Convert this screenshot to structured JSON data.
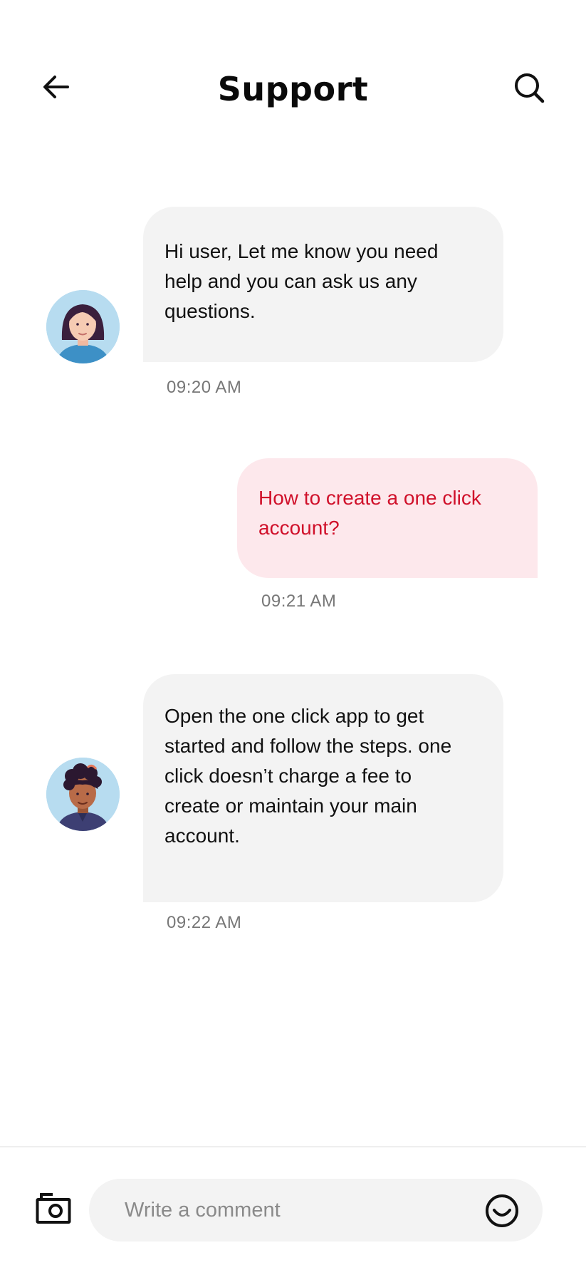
{
  "header": {
    "title": "Support"
  },
  "messages": [
    {
      "direction": "incoming",
      "lines": [
        "Hi user, Let me know you need",
        "help and you can ask us any",
        "questions."
      ],
      "time": "09:20 AM",
      "avatar": "female-support-avatar"
    },
    {
      "direction": "outgoing",
      "lines": [
        "How to create a one click",
        "account?"
      ],
      "time": "09:21 AM"
    },
    {
      "direction": "incoming",
      "lines": [
        "Open the one click app to get",
        "started and follow the steps. one",
        "click doesn’t charge a fee to",
        "create or maintain your main",
        "account."
      ],
      "time": "09:22 AM",
      "avatar": "male-support-avatar"
    }
  ],
  "composer": {
    "placeholder": "Write a comment"
  },
  "icons": {
    "back": "arrow-left-icon",
    "search": "search-icon",
    "camera": "camera-icon",
    "emoji": "smiley-icon"
  },
  "colors": {
    "incoming_bubble": "#f3f3f3",
    "outgoing_bubble": "#fde8ec",
    "outgoing_text": "#d0102a",
    "avatar_background": "#b7dcf0"
  }
}
